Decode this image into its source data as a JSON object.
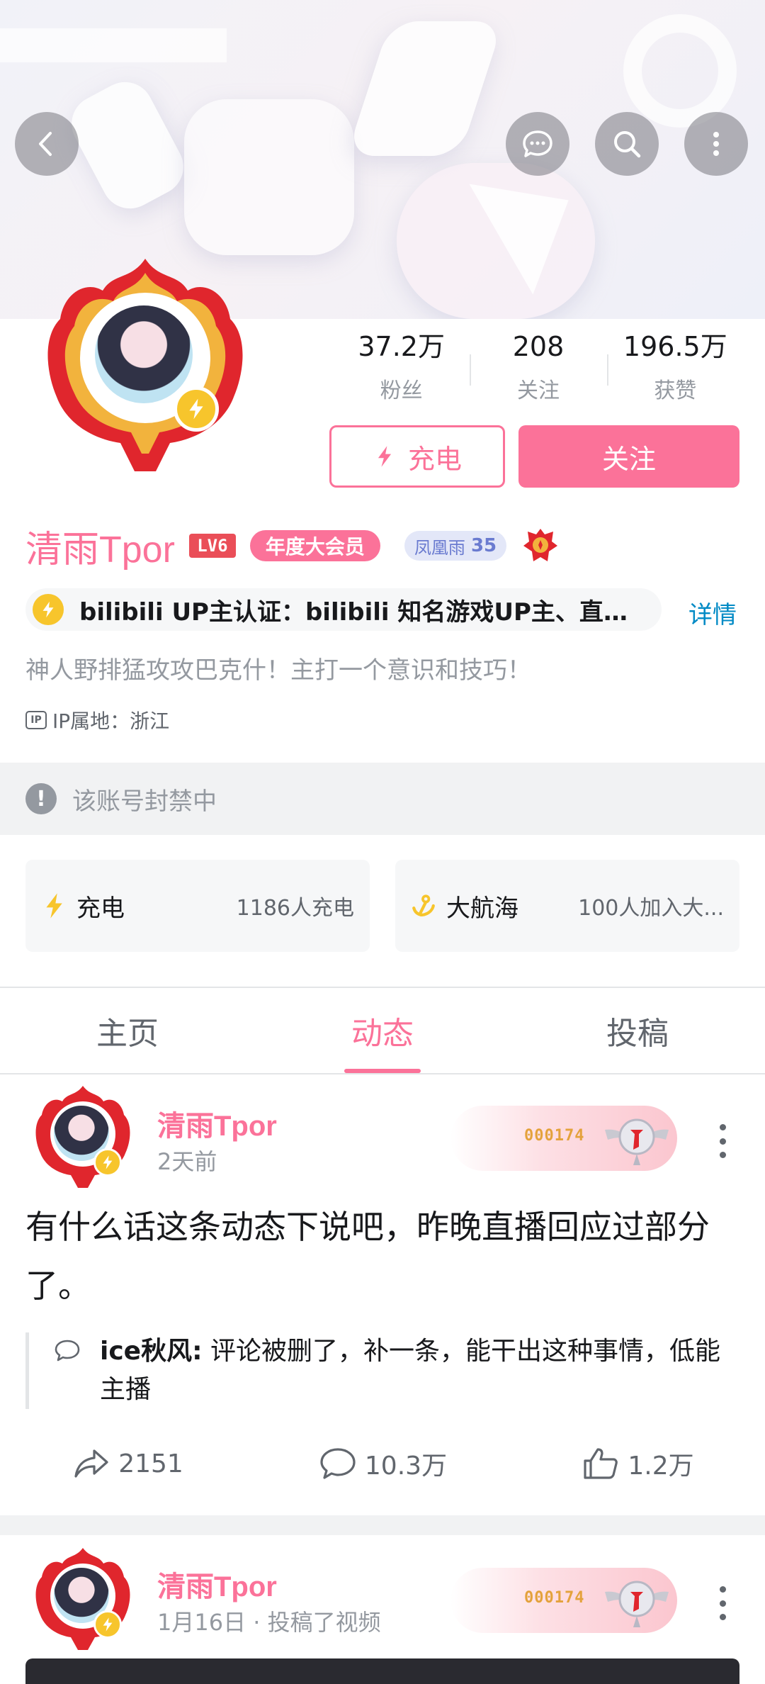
{
  "header": {
    "back_icon": "chevron-left-icon",
    "message_icon": "chat-bubble-icon",
    "search_icon": "search-icon",
    "more_icon": "more-vertical-icon"
  },
  "stats": [
    {
      "value": "37.2万",
      "label": "粉丝"
    },
    {
      "value": "208",
      "label": "关注"
    },
    {
      "value": "196.5万",
      "label": "获赞"
    }
  ],
  "buttons": {
    "charge": "充电",
    "follow": "关注"
  },
  "profile": {
    "name": "清雨Tpor",
    "level": "LV6",
    "vip_label": "年度大会员",
    "medal_name": "凤凰雨",
    "medal_level": "35",
    "verify_text": "bilibili UP主认证：bilibili 知名游戏UP主、直播...",
    "detail_link": "详情",
    "bio": "神人野排猛攻攻巴克什！主打一个意识和技巧！",
    "ip_badge": "IP",
    "ip_location": "IP属地：浙江"
  },
  "banned": {
    "text": "该账号封禁中"
  },
  "cards": [
    {
      "title": "充电",
      "value": "1186人充电",
      "icon": "lightning-icon"
    },
    {
      "title": "大航海",
      "value": "100人加入大...",
      "icon": "anchor-icon"
    }
  ],
  "tabs": [
    {
      "label": "主页",
      "active": false
    },
    {
      "label": "动态",
      "active": true
    },
    {
      "label": "投稿",
      "active": false
    }
  ],
  "posts": [
    {
      "author": "清雨Tpor",
      "time": "2天前",
      "fan_number": "000174",
      "text": "有什么话这条动态下说吧，昨晚直播回应过部分了。",
      "quote_author": "ice秋风:",
      "quote_text": " 评论被删了，补一条，能干出这种事情，低能主播",
      "share_count": "2151",
      "comment_count": "10.3万",
      "like_count": "1.2万"
    },
    {
      "author": "清雨Tpor",
      "time": "1月16日 · 投稿了视频",
      "fan_number": "000174"
    }
  ],
  "colors": {
    "accent": "#fb7299",
    "link": "#008ac5",
    "muted": "#9499a0",
    "badge_yellow": "#f7c52c"
  }
}
